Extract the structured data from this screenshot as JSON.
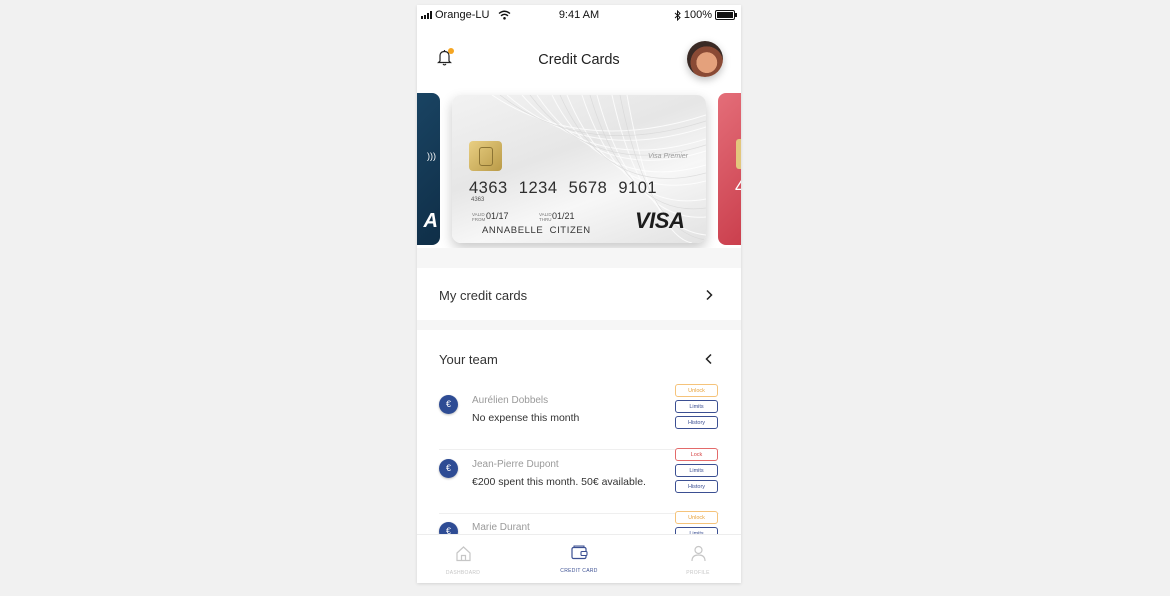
{
  "status_bar": {
    "carrier": "Orange-LU",
    "time": "9:41 AM",
    "battery": "100%"
  },
  "header": {
    "title": "Credit Cards",
    "notification_dot_color": "#f5a623"
  },
  "card": {
    "number": "4363 1234 5678 9101",
    "number_small": "4363",
    "valid_from_label": "VALID FROM",
    "valid_from": "01/17",
    "valid_thru_label": "VALID THRU",
    "valid_thru": "01/21",
    "holder": "ANNABELLE CITIZEN",
    "brand": "VISA",
    "brand_small": "Visa Premier",
    "left_card_brand": "A",
    "right_card_number": "4"
  },
  "my_cards": {
    "label": "My credit cards"
  },
  "team": {
    "title": "Your team",
    "members": [
      {
        "name": "Aurélien Dobbels",
        "info": "No expense this month",
        "lock_label": "Unlock",
        "limits_label": "Limits",
        "history_label": "History"
      },
      {
        "name": "Jean-Pierre Dupont",
        "info": "€200 spent this month. 50€ available.",
        "lock_label": "Lock",
        "limits_label": "Limits",
        "history_label": "History"
      },
      {
        "name": "Marie Durant",
        "info": "",
        "lock_label": "Unlock",
        "limits_label": "Limits",
        "history_label": "History"
      }
    ],
    "coin_symbol": "€"
  },
  "tabbar": {
    "tabs": [
      {
        "label": "DASHBOARD",
        "icon": "home-icon"
      },
      {
        "label": "CREDIT CARD",
        "icon": "wallet-icon",
        "active": true
      },
      {
        "label": "PROFILE",
        "icon": "person-icon"
      }
    ]
  },
  "colors": {
    "accent": "#3b4f92",
    "unlock": "#e8a23b",
    "lock": "#d64545",
    "coin": "#2e4c94"
  }
}
